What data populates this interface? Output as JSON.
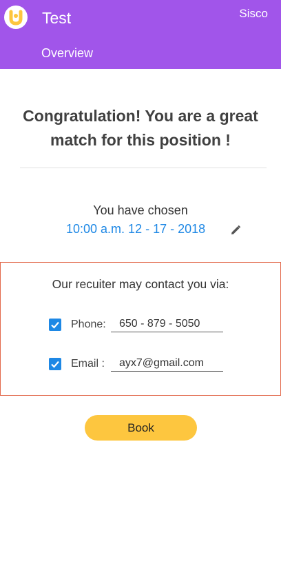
{
  "header": {
    "app_title": "Test",
    "user_name": "Sisco",
    "nav_tab": "Overview",
    "background_color": "#a155ea",
    "logo_icon": "brand-logo-icon"
  },
  "main": {
    "headline": "Congratulation! You are a great match for this position !",
    "chosen_label": "You have chosen",
    "chosen_time": "10:00 a.m. 12 - 17 - 2018",
    "edit_icon": "pencil-icon"
  },
  "contact": {
    "title": "Our recuiter may contact you via:",
    "phone": {
      "label": "Phone:",
      "value": "650 - 879 - 5050",
      "checked": true
    },
    "email": {
      "label": "Email :",
      "value": "ayx7@gmail.com",
      "checked": true
    },
    "border_color": "#e2684a",
    "checkbox_color": "#1e88e5"
  },
  "actions": {
    "book_label": "Book",
    "book_color": "#fdc63f"
  }
}
